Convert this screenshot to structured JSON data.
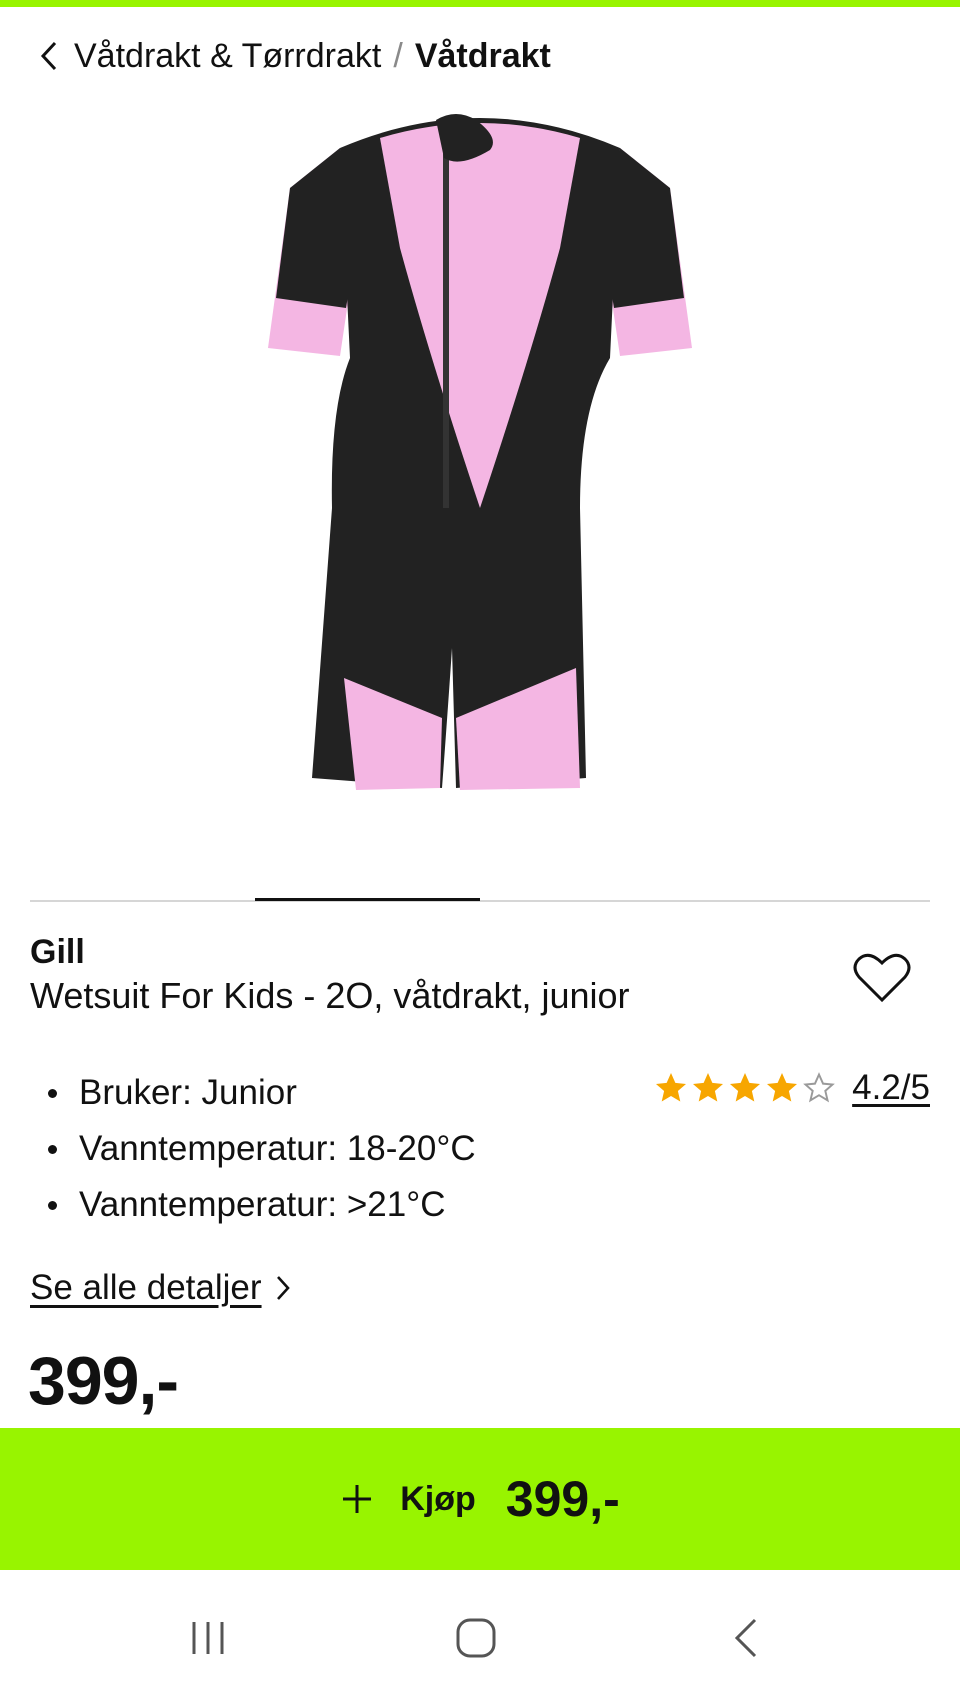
{
  "breadcrumb": {
    "parent": "Våtdrakt & Tørrdrakt",
    "separator": "/",
    "current": "Våtdrakt"
  },
  "product": {
    "brand": "Gill",
    "title": "Wetsuit For Kids - 2O, våtdrakt, junior",
    "image_icon": "wetsuit-image",
    "specs": [
      "Bruker: Junior",
      "Vanntemperatur: 18-20°C",
      "Vanntemperatur: >21°C"
    ],
    "rating": {
      "value": 4.2,
      "max": 5,
      "label": "4.2/5",
      "filled_stars": 4
    },
    "details_link": "Se alle detaljer",
    "price": "399,-"
  },
  "buy": {
    "label": "Kjøp",
    "price": "399,-"
  },
  "colors": {
    "accent": "#98f400",
    "star": "#f7a600",
    "suit_pink": "#f4b6e3",
    "suit_black": "#222222"
  }
}
